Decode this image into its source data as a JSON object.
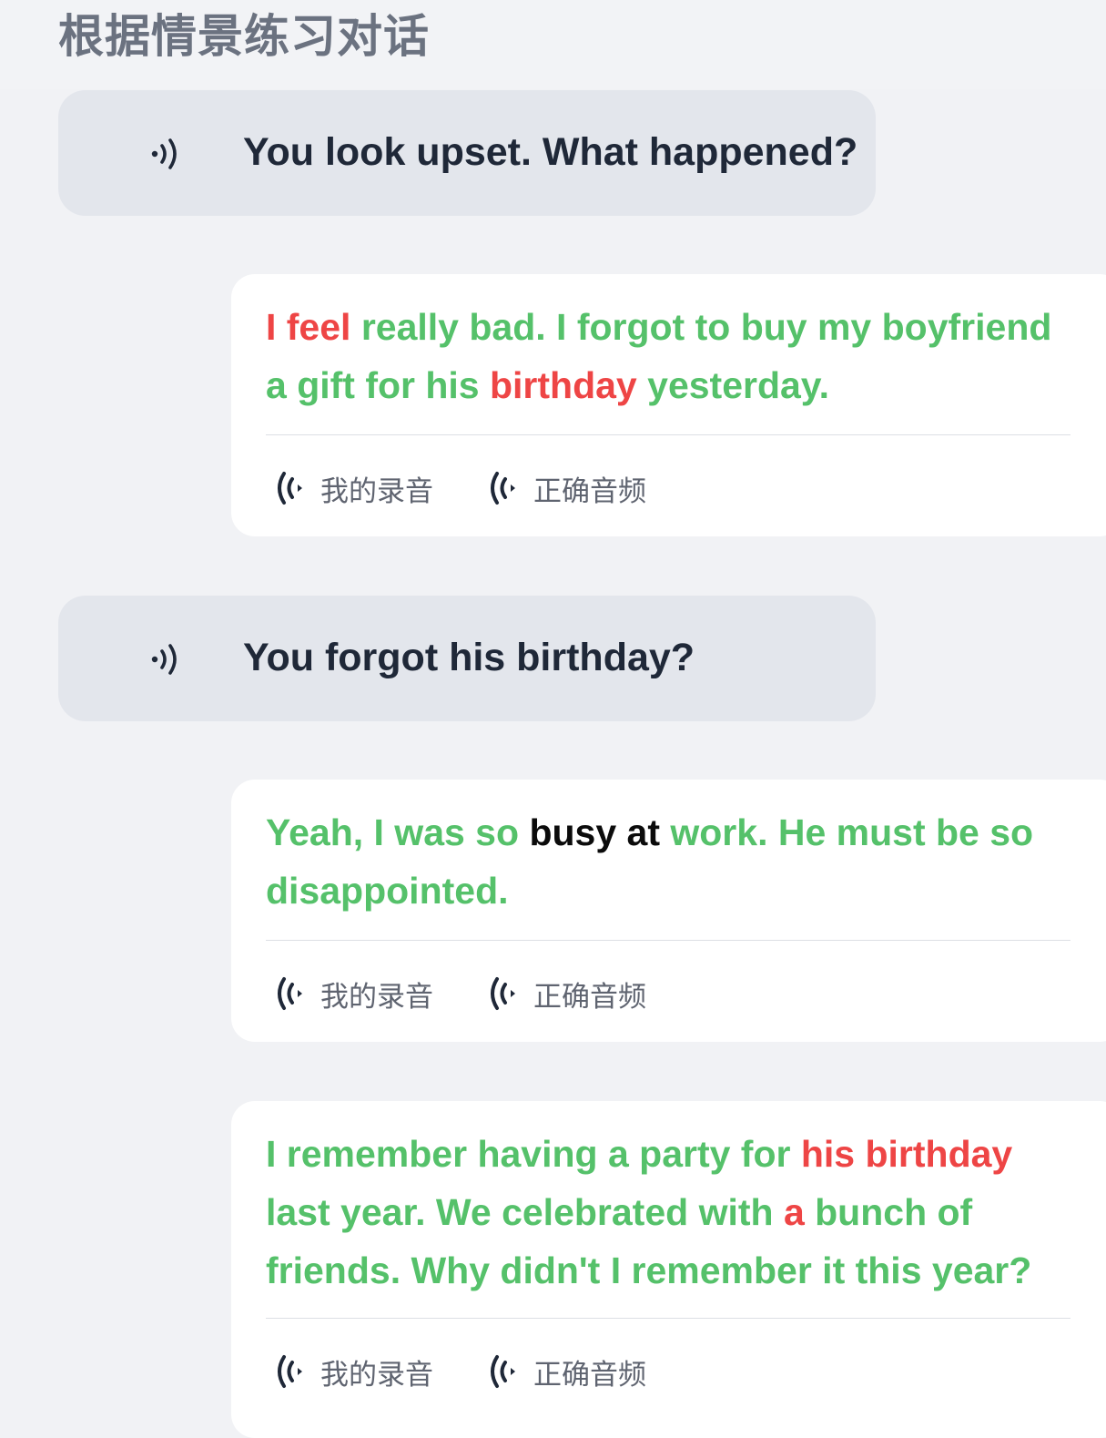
{
  "page": {
    "title": "根据情景练习对话"
  },
  "colors": {
    "correct": "#55c16a",
    "wrong": "#ee4545",
    "neutral": "#0b0b0b",
    "prompt_bg": "#e3e6ec",
    "card_bg": "#ffffff"
  },
  "dialogue": [
    {
      "prompt": {
        "text": "You look upset. What happened?",
        "icon": "speaker-icon"
      },
      "answer": {
        "segments": [
          {
            "text": "I feel",
            "status": "wrong"
          },
          {
            "text": " really bad. I forgot to buy my boyfriend a gift for his ",
            "status": "correct"
          },
          {
            "text": "birthday",
            "status": "wrong"
          },
          {
            "text": " yesterday.",
            "status": "correct"
          }
        ],
        "my_recording_label": "我的录音",
        "correct_audio_label": "正确音频"
      }
    },
    {
      "prompt": {
        "text": "You forgot his birthday?",
        "icon": "speaker-icon"
      },
      "answer": {
        "segments": [
          {
            "text": "Yeah, I was so ",
            "status": "correct"
          },
          {
            "text": "busy at",
            "status": "neutral"
          },
          {
            "text": " work. He must be so disappointed.",
            "status": "correct"
          }
        ],
        "my_recording_label": "我的录音",
        "correct_audio_label": "正确音频"
      }
    },
    {
      "answer": {
        "segments": [
          {
            "text": "I remember having a party for ",
            "status": "correct"
          },
          {
            "text": "his birthday",
            "status": "wrong"
          },
          {
            "text": " last year. We celebrated with ",
            "status": "correct"
          },
          {
            "text": "a",
            "status": "wrong"
          },
          {
            "text": " bunch of friends. Why didn't I remember it this year?",
            "status": "correct"
          }
        ],
        "my_recording_label": "我的录音",
        "correct_audio_label": "正确音频"
      }
    }
  ]
}
